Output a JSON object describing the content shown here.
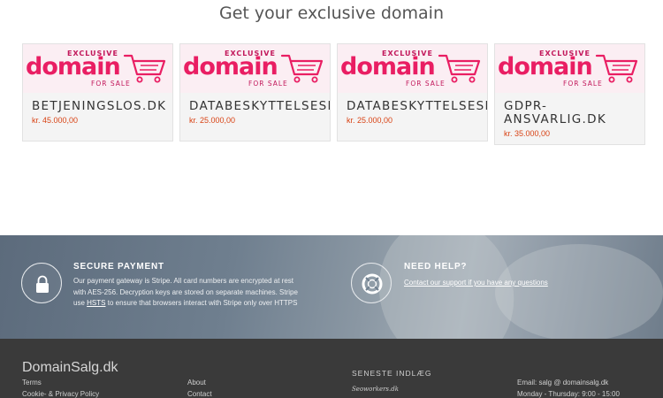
{
  "heading": "Get your exclusive domain",
  "domain_banner": {
    "top": "EXCLUSIVE",
    "main": "domain",
    "bottom": "FOR SALE",
    "color": "#e91e63"
  },
  "domains": [
    {
      "name": "BETJENINGSLOS.DK",
      "price": "kr. 45.000,00"
    },
    {
      "name": "DATABESKYTTELSESPA",
      "price": "kr. 25.000,00"
    },
    {
      "name": "DATABESKYTTELSESPA",
      "price": "kr. 25.000,00"
    },
    {
      "name": "GDPR-ANSVARLIG.DK",
      "price": "kr. 35.000,00"
    }
  ],
  "secure": {
    "title": "SECURE PAYMENT",
    "text_1": "Our payment gateway is Stripe. All card numbers are encrypted at rest with AES-256. Decryption keys are stored on separate machines. Stripe use",
    "link": "HSTS",
    "text_2": "to ensure that browsers interact with Stripe only over HTTPS",
    "icon": "lock-icon"
  },
  "help": {
    "title": "NEED HELP?",
    "link": "Contact our support if you have any questions",
    "icon": "lifebuoy-icon"
  },
  "footer": {
    "brand": "DomainSalg.dk",
    "col1": [
      "Terms",
      "Cookie- & Privacy Policy"
    ],
    "col2": [
      "About",
      "Contact"
    ],
    "latest_heading": "SENESTE INDLÆG",
    "latest_post": "Seoworkers.dk",
    "email": "Email: salg @ domainsalg.dk",
    "hours": "Monday - Thursday: 9:00 - 15:00"
  }
}
